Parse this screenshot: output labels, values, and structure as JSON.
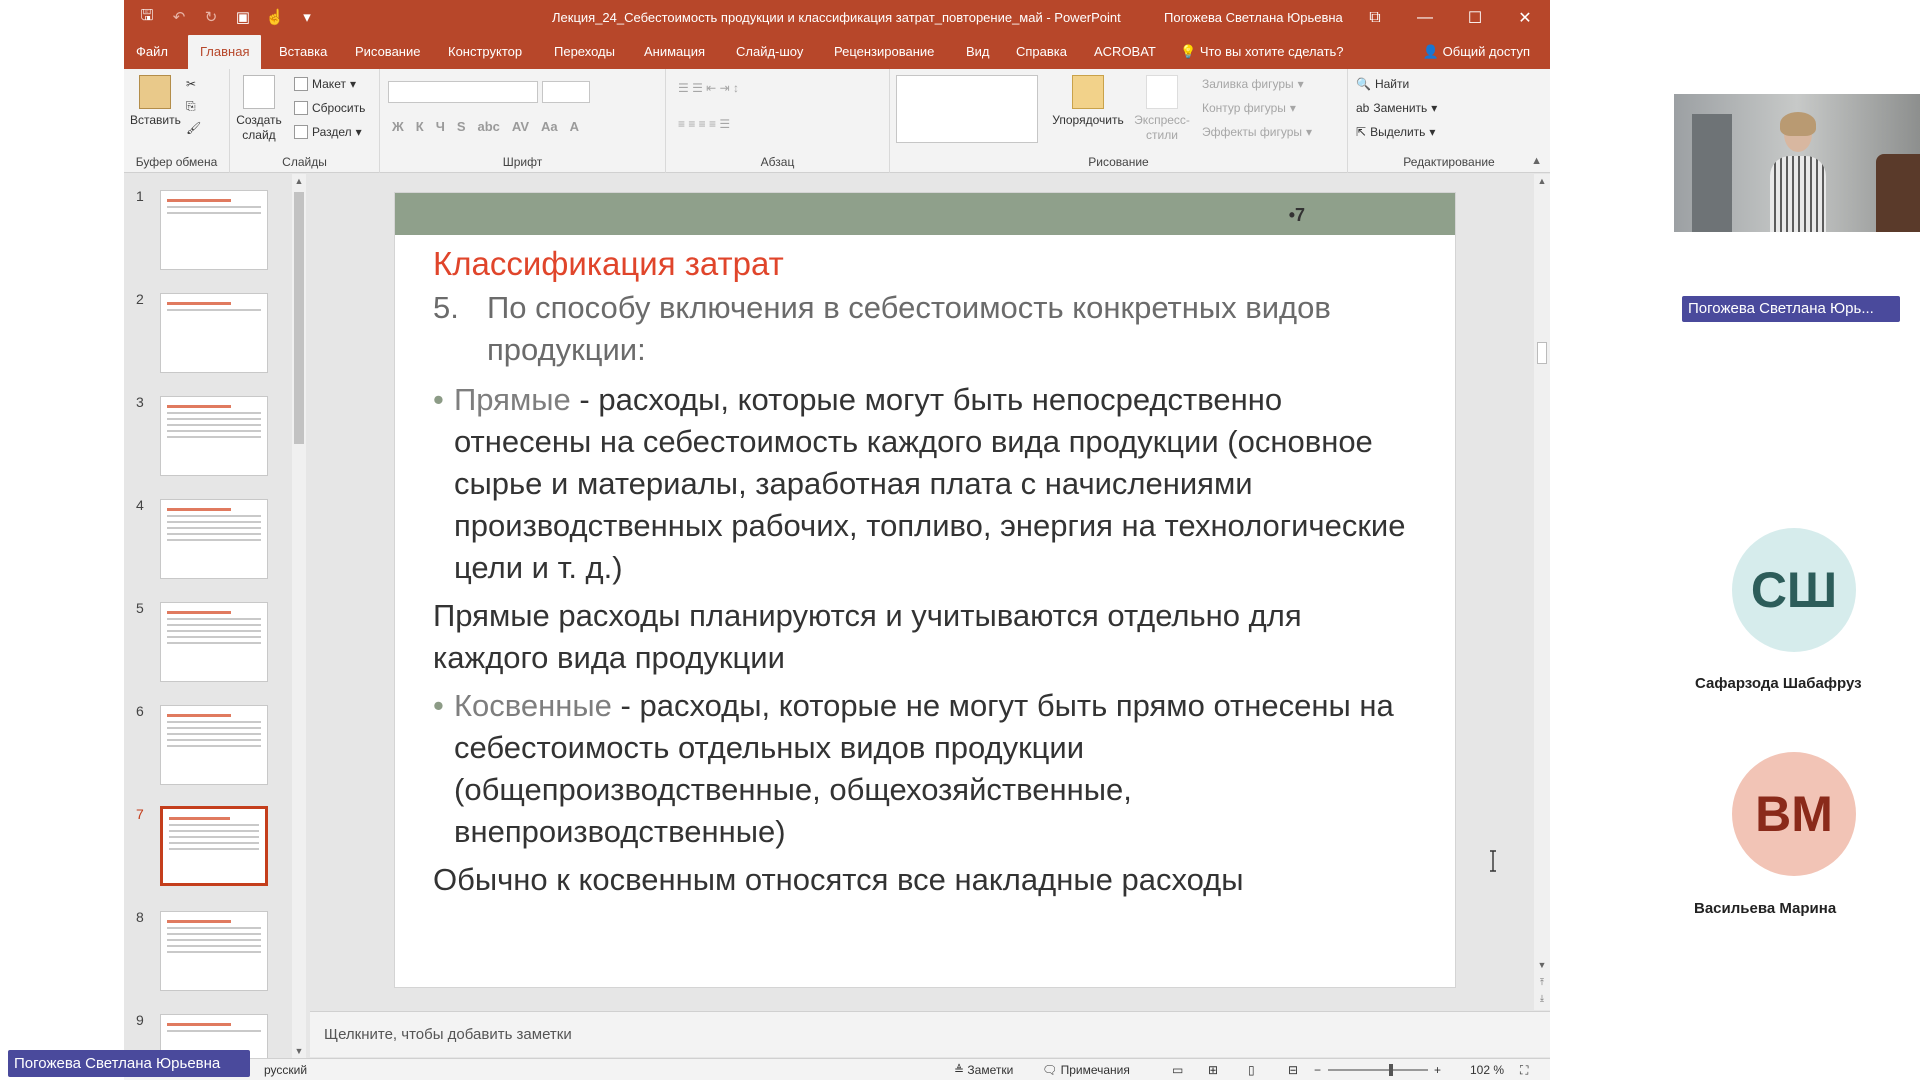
{
  "window": {
    "title": "Лекция_24_Себестоимость продукции и классификация затрат_повторение_май  -  PowerPoint",
    "user": "Погожева Светлана Юрьевна",
    "minimize": "—",
    "maximize": "☐",
    "close": "✕",
    "ribbon_display": "⧉"
  },
  "qat": {
    "save": "🖫",
    "undo": "↶",
    "redo": "↻",
    "present": "▣",
    "touch": "☝",
    "more": "▾"
  },
  "tabs": [
    {
      "label": "Файл"
    },
    {
      "label": "Главная"
    },
    {
      "label": "Вставка"
    },
    {
      "label": "Рисование"
    },
    {
      "label": "Конструктор"
    },
    {
      "label": "Переходы"
    },
    {
      "label": "Анимация"
    },
    {
      "label": "Слайд-шоу"
    },
    {
      "label": "Рецензирование"
    },
    {
      "label": "Вид"
    },
    {
      "label": "Справка"
    },
    {
      "label": "ACROBAT"
    }
  ],
  "tell_me": "Что вы хотите сделать?",
  "share": "Общий доступ",
  "ribbon": {
    "clipboard": {
      "label": "Буфер обмена",
      "paste": "Вставить"
    },
    "slides": {
      "label": "Слайды",
      "new_slide": "Создать слайд",
      "layout": "Макет",
      "reset": "Сбросить",
      "section": "Раздел"
    },
    "font": {
      "label": "Шрифт",
      "bold": "Ж",
      "italic": "К",
      "underline": "Ч",
      "strike": "S",
      "strike2": "abc",
      "spacing": "AV",
      "case": "Aa",
      "color": "A"
    },
    "paragraph": {
      "label": "Абзац"
    },
    "drawing": {
      "label": "Рисование",
      "arrange": "Упорядочить",
      "quick_styles": "Экспресс-стили",
      "fill": "Заливка фигуры",
      "outline": "Контур фигуры",
      "effects": "Эффекты фигуры"
    },
    "editing": {
      "label": "Редактирование",
      "find": "Найти",
      "replace": "Заменить",
      "select": "Выделить"
    }
  },
  "thumbnails": [
    {
      "num": "1"
    },
    {
      "num": "2"
    },
    {
      "num": "3"
    },
    {
      "num": "4"
    },
    {
      "num": "5"
    },
    {
      "num": "6"
    },
    {
      "num": "7"
    },
    {
      "num": "8"
    },
    {
      "num": "9"
    }
  ],
  "slide": {
    "number": "•7",
    "title": "Классификация затрат",
    "item5_num": "5.",
    "item5_text": "По способу включения в себестоимость конкретных видов продукции:",
    "direct_term": "Прямые",
    "direct_text": " - расходы, которые могут быть непосредственно отнесены на себестоимость каждого вида продукции (основное сырье и материалы, заработная плата с начислениями производственных рабочих, топливо, энергия на технологические цели и т. д.)",
    "direct_note": "Прямые расходы планируются и учитываются отдельно для каждого вида продукции",
    "indirect_term": "Косвенные",
    "indirect_text": " -  расходы, которые не могут быть прямо отнесены на себестоимость отдельных видов продукции (общепроизводственные, общехозяйственные, внепроизводственные)",
    "indirect_note": "Обычно к косвенным относятся все накладные расходы"
  },
  "notes_placeholder": "Щелкните, чтобы добавить заметки",
  "status": {
    "language": "русский",
    "notes": "Заметки",
    "comments": "Примечания",
    "zoom": "102 %"
  },
  "participants": [
    {
      "name": "Погожева Светлана Юрь...",
      "initials": ""
    },
    {
      "name": "Сафарзода Шабафруз",
      "initials": "СШ"
    },
    {
      "name": "Васильева Марина",
      "initials": "ВМ"
    }
  ],
  "bottom_tag": "Погожева Светлана Юрьевна",
  "colors": {
    "ppt_red": "#b7472a",
    "slide_title": "#e0452b",
    "slide_band": "#8fa08b",
    "tag_bg": "#4a4a9c"
  }
}
